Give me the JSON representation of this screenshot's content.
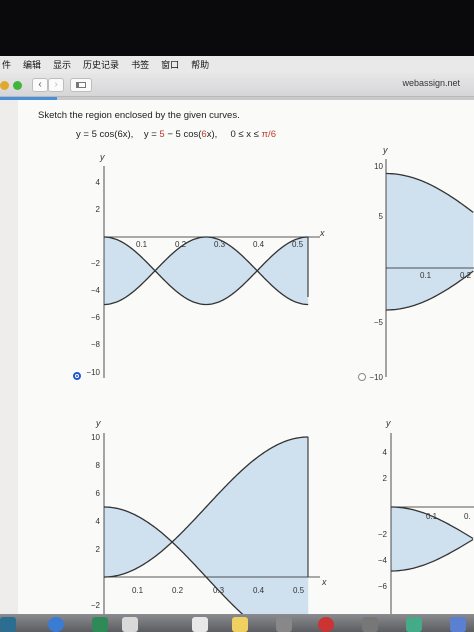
{
  "menubar": {
    "items": [
      "件",
      "编辑",
      "显示",
      "历史记录",
      "书签",
      "窗口",
      "帮助"
    ]
  },
  "browser": {
    "back_label": "‹",
    "forward_label": "›",
    "url": "webassign.net",
    "progress": 0.12
  },
  "question": {
    "prompt": "Sketch the region enclosed by the given curves.",
    "eq_left": "y = 5 cos(6x),    y = ",
    "eq_red1": "5",
    "eq_mid": " − 5 cos(",
    "eq_red2": "6",
    "eq_right": "x),     0 ≤ x ≤ ",
    "eq_red3": "π/6"
  },
  "graphs": [
    {
      "id": "a",
      "selected": true,
      "y_label": "y",
      "x_label": "x",
      "x_ticks": [
        "0.1",
        "0.2",
        "0.3",
        "0.4",
        "0.5"
      ],
      "y_ticks": [
        "4",
        "2",
        "−2",
        "−4",
        "−6",
        "−8",
        "−10"
      ]
    },
    {
      "id": "b",
      "selected": false,
      "y_label": "y",
      "x_ticks": [
        "0.1",
        "0.2"
      ],
      "y_ticks": [
        "10",
        "5",
        "−5",
        "−10"
      ]
    },
    {
      "id": "c",
      "y_label": "y",
      "x_label": "x",
      "x_ticks": [
        "0.1",
        "0.2",
        "0.3",
        "0.4",
        "0.5"
      ],
      "y_ticks": [
        "10",
        "8",
        "6",
        "4",
        "2",
        "−2"
      ]
    },
    {
      "id": "d",
      "y_label": "y",
      "x_ticks": [
        "0.1",
        "0."
      ],
      "y_ticks": [
        "4",
        "2",
        "−2",
        "−4",
        "−6"
      ]
    }
  ],
  "colors": {
    "region_fill": "#cfe0ee",
    "curve": "#333333",
    "radio_selected": "#2255cc"
  }
}
